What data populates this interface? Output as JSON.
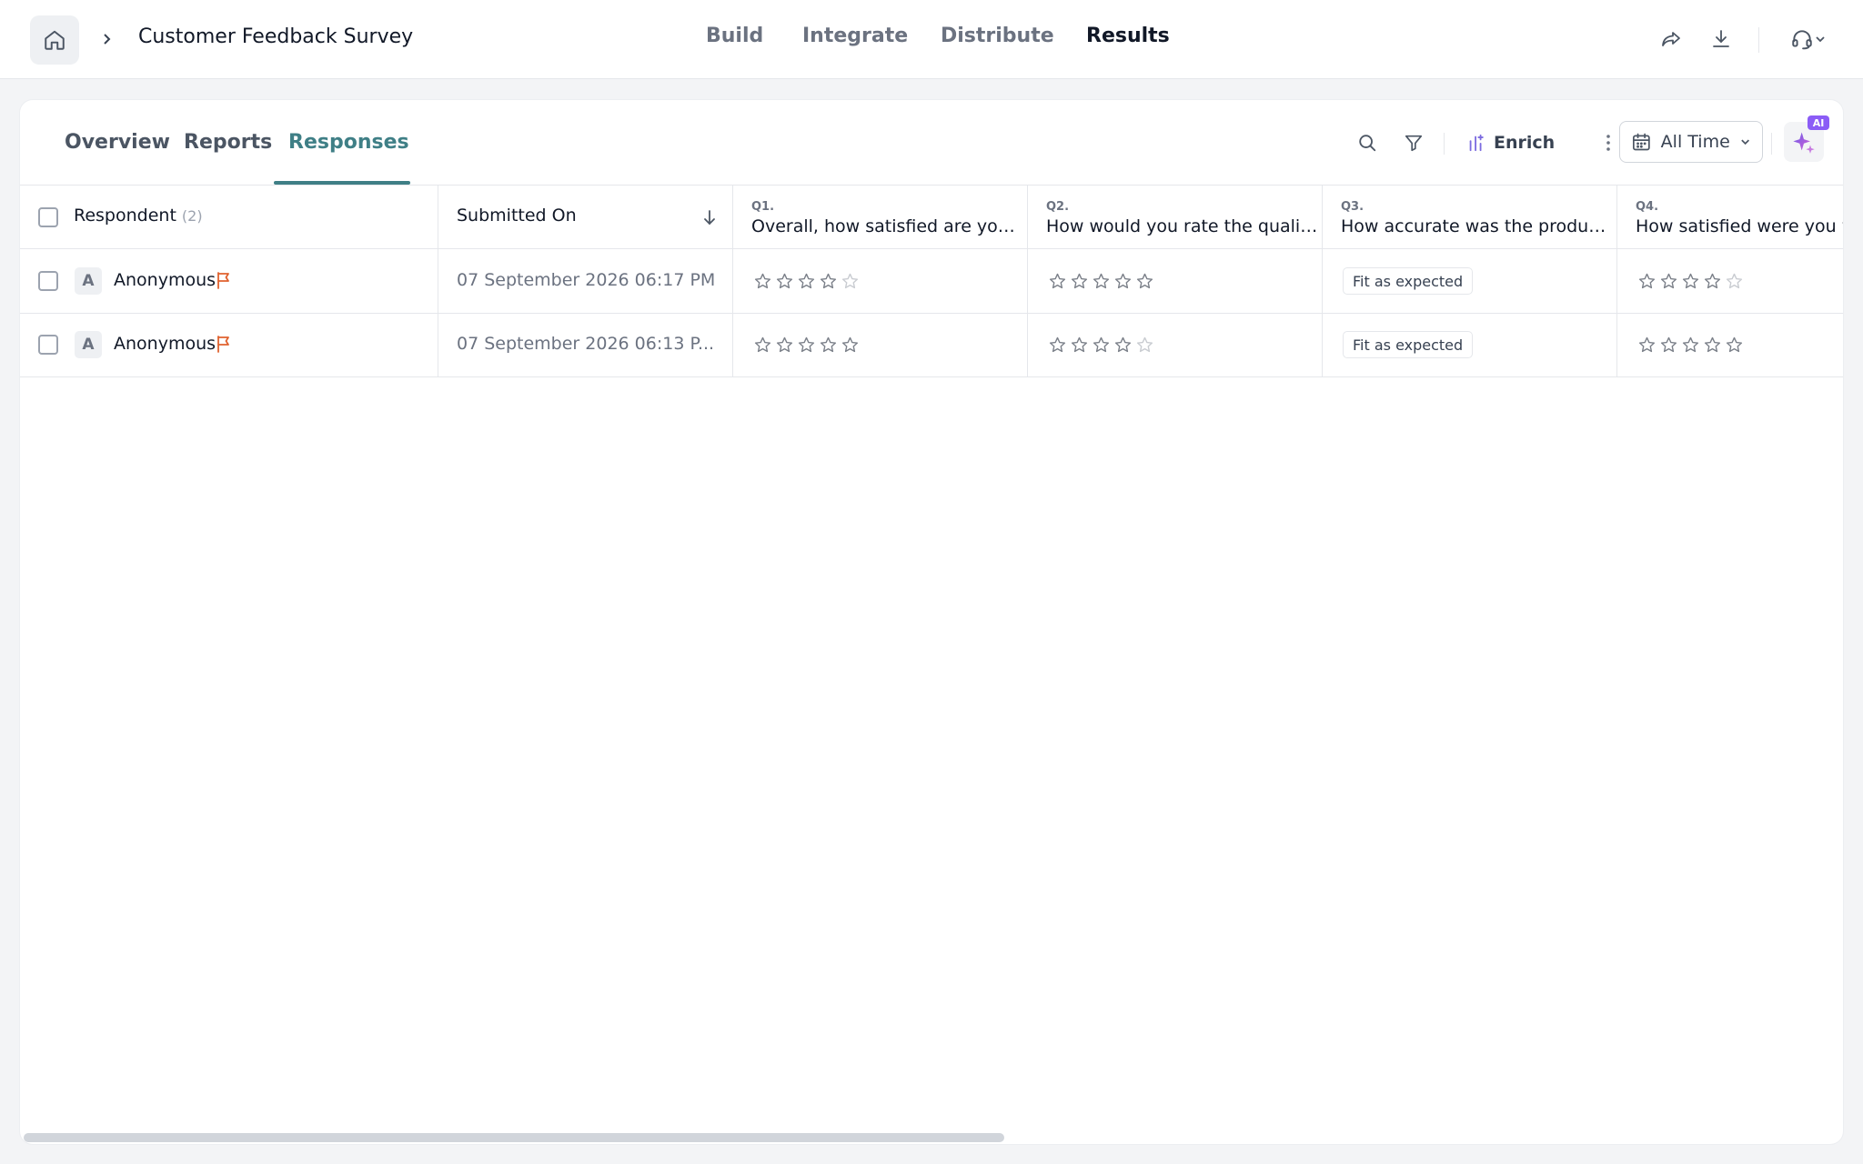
{
  "header": {
    "survey_title": "Customer Feedback Survey",
    "nav": [
      {
        "label": "Build"
      },
      {
        "label": "Integrate"
      },
      {
        "label": "Distribute"
      },
      {
        "label": "Results",
        "active": true
      }
    ],
    "icons": [
      "home-icon",
      "chevron-right-icon",
      "share-icon",
      "download-icon",
      "headset-icon",
      "chevron-down-icon"
    ]
  },
  "subnav": {
    "tabs": [
      {
        "label": "Overview"
      },
      {
        "label": "Reports"
      },
      {
        "label": "Responses",
        "active": true
      }
    ],
    "enrich_label": "Enrich",
    "time_filter": "All Time",
    "ai_badge": "AI",
    "accent_color": "#3f7f86"
  },
  "table": {
    "respondent_header": "Respondent",
    "respondent_count": "(2)",
    "submitted_header": "Submitted On",
    "questions": [
      {
        "num": "Q1.",
        "text": "Overall, how satisfied are you ..."
      },
      {
        "num": "Q2.",
        "text": "How would you rate the qualit..."
      },
      {
        "num": "Q3.",
        "text": "How accurate was the produc..."
      },
      {
        "num": "Q4.",
        "text": "How satisfied were you w"
      }
    ],
    "rows": [
      {
        "avatar": "A",
        "name": "Anonymous",
        "submitted": "07 September 2026 06:17 PM",
        "q1_rating": 4,
        "q2_rating": 5,
        "q3_answer": "Fit as expected",
        "q4_rating": 4
      },
      {
        "avatar": "A",
        "name": "Anonymous",
        "submitted": "07 September 2026 06:13 P...",
        "q1_rating": 5,
        "q2_rating": 4,
        "q3_answer": "Fit as expected",
        "q4_rating": 5
      }
    ],
    "max_rating": 5
  }
}
